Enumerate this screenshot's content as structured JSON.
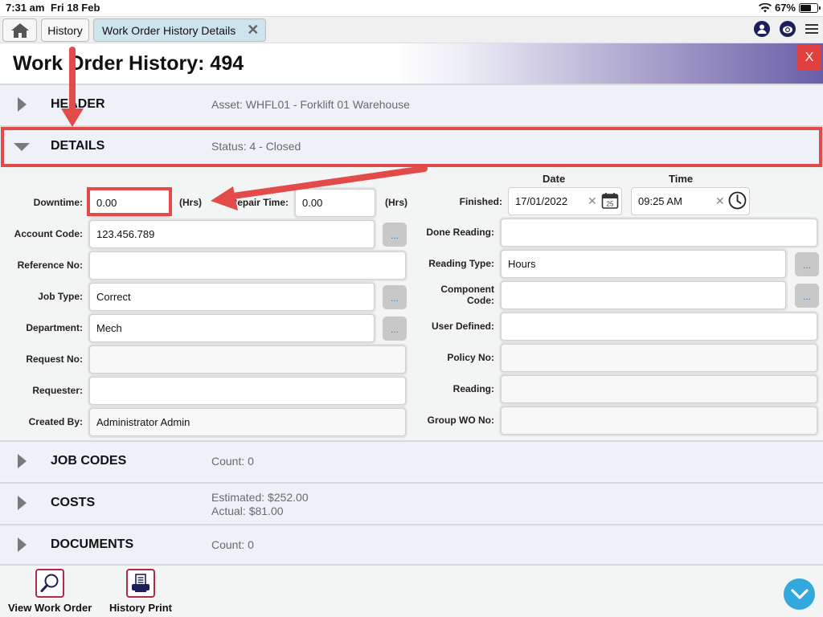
{
  "status_bar": {
    "time": "7:31 am",
    "date": "Fri 18 Feb",
    "battery": "67%",
    "battery_level": 0.67
  },
  "tabs": {
    "home_icon": "home-icon",
    "history_label": "History",
    "active_label": "Work Order History Details",
    "close_glyph": "✕"
  },
  "top_icons": [
    "user-icon",
    "sync-icon",
    "menu-icon"
  ],
  "page": {
    "title": "Work Order History: 494",
    "close_label": "X"
  },
  "sections": {
    "header": {
      "label": "HEADER",
      "summary": "Asset: WHFL01 - Forklift 01 Warehouse"
    },
    "details": {
      "label": "DETAILS",
      "summary": "Status: 4 - Closed"
    },
    "job_codes": {
      "label": "JOB CODES",
      "summary": "Count: 0"
    },
    "costs": {
      "label": "COSTS",
      "summary_1": "Estimated: $252.00",
      "summary_2": "Actual: $81.00"
    },
    "documents": {
      "label": "DOCUMENTS",
      "summary": "Count: 0"
    }
  },
  "details_form": {
    "downtime": {
      "label": "Downtime:",
      "value": "0.00",
      "unit": "(Hrs)"
    },
    "repair_time": {
      "label": "Repair Time:",
      "value": "0.00",
      "unit": "(Hrs)"
    },
    "account_code": {
      "label": "Account Code:",
      "value": "123.456.789"
    },
    "reference_no": {
      "label": "Reference No:",
      "value": ""
    },
    "job_type": {
      "label": "Job Type:",
      "value": "Correct"
    },
    "department": {
      "label": "Department:",
      "value": "Mech"
    },
    "request_no": {
      "label": "Request No:",
      "value": ""
    },
    "requester": {
      "label": "Requester:",
      "value": ""
    },
    "created_by": {
      "label": "Created By:",
      "value": "Administrator Admin"
    },
    "date_header": "Date",
    "time_header": "Time",
    "finished": {
      "label": "Finished:",
      "date": "17/01/2022",
      "time": "09:25 AM",
      "calendar_day": "25"
    },
    "done_reading": {
      "label": "Done Reading:",
      "value": ""
    },
    "reading_type": {
      "label": "Reading Type:",
      "value": "Hours"
    },
    "component_code": {
      "label_1": "Component",
      "label_2": "Code:",
      "value": ""
    },
    "user_defined": {
      "label": "User Defined:",
      "value": ""
    },
    "policy_no": {
      "label": "Policy No:",
      "value": ""
    },
    "reading": {
      "label": "Reading:",
      "value": ""
    },
    "group_wo_no": {
      "label": "Group WO No:",
      "value": ""
    },
    "lookup_glyph": "..."
  },
  "bottom_bar": {
    "view_work_order": "View Work Order",
    "history_print": "History Print"
  },
  "colors": {
    "accent_red": "#e24b4a",
    "fab_blue": "#33a8dc",
    "tab_active": "#cde4ec",
    "icon_border": "#b0284a"
  }
}
